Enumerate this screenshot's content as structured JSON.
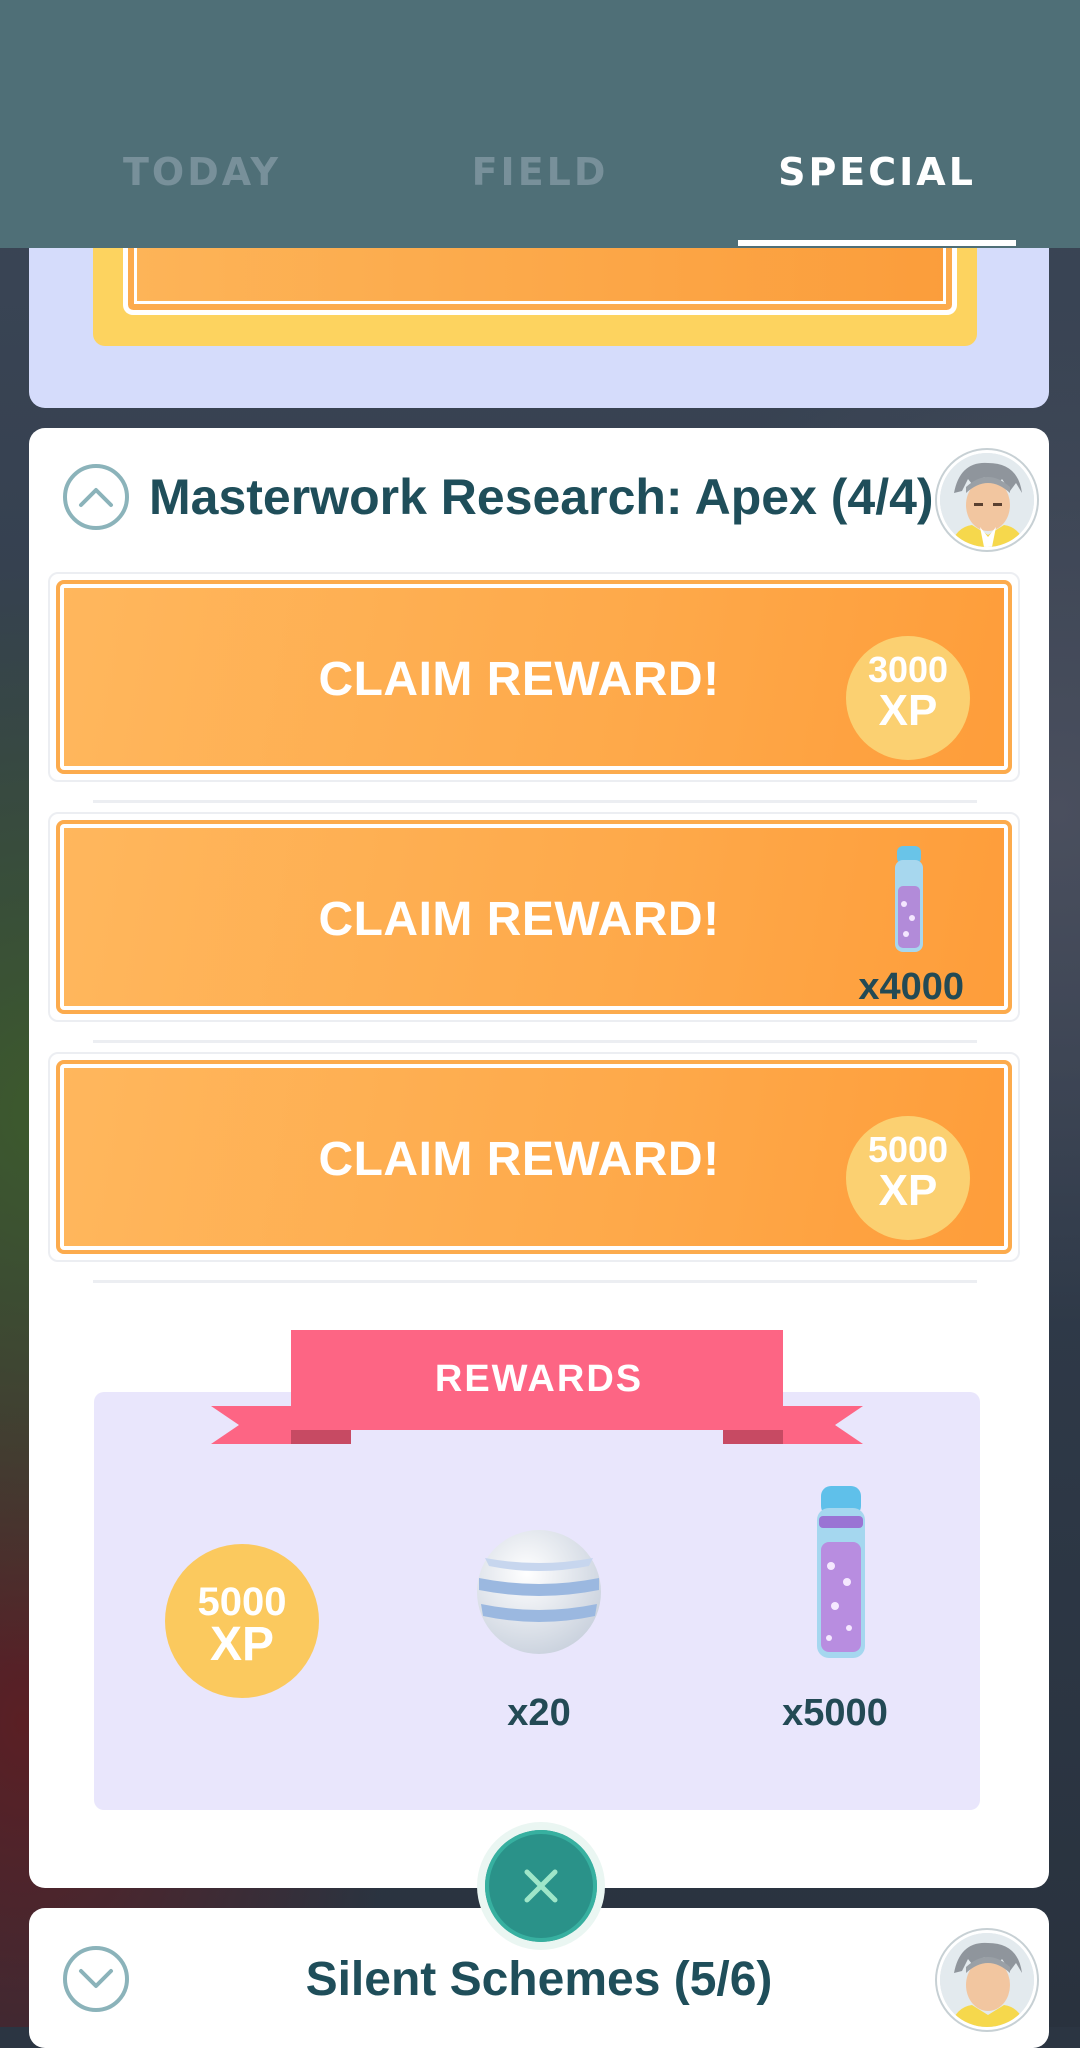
{
  "tabs": [
    {
      "label": "TODAY",
      "active": false
    },
    {
      "label": "FIELD",
      "active": false
    },
    {
      "label": "SPECIAL",
      "active": true
    }
  ],
  "research": {
    "title": "Masterwork Research: Apex (4/4)",
    "tasks": [
      {
        "label": "CLAIM REWARD!",
        "reward_type": "xp",
        "reward_amount": "3000",
        "reward_unit": "XP"
      },
      {
        "label": "CLAIM REWARD!",
        "reward_type": "stardust",
        "reward_amount": "x4000"
      },
      {
        "label": "CLAIM REWARD!",
        "reward_type": "xp",
        "reward_amount": "5000",
        "reward_unit": "XP"
      }
    ],
    "rewards": {
      "heading": "REWARDS",
      "items": [
        {
          "type": "xp",
          "amount": "5000",
          "unit": "XP"
        },
        {
          "type": "poke-ball-icon",
          "count": "x20"
        },
        {
          "type": "stardust-icon",
          "count": "x5000"
        }
      ]
    }
  },
  "next_research": {
    "title": "Silent Schemes (5/6)"
  },
  "colors": {
    "header": "#4f6f77",
    "claim_orange": "#fea94a",
    "title_text": "#1f4e5a",
    "ribbon": "#fd6584",
    "xp_badge": "#fbd071"
  }
}
